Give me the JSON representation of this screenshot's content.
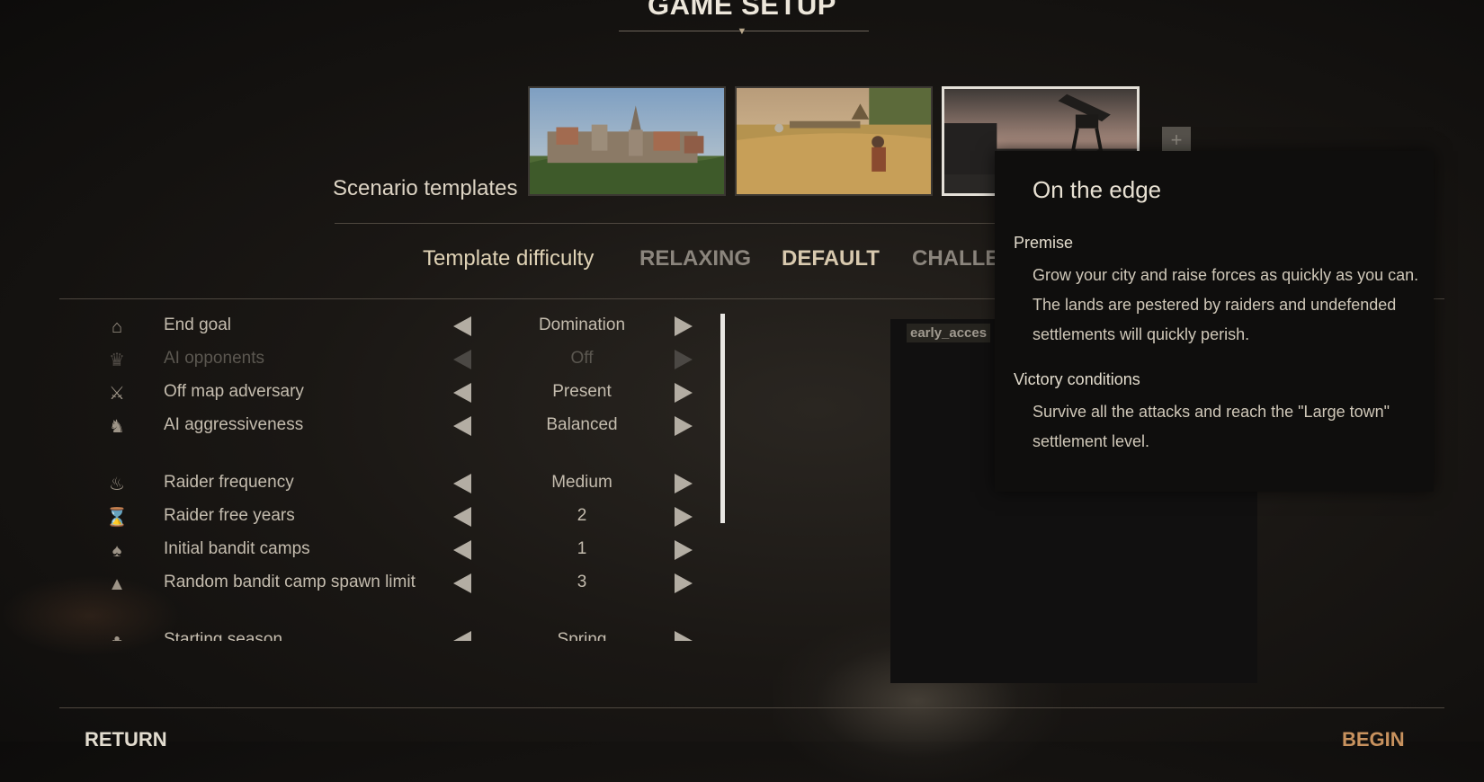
{
  "title": "GAME SETUP",
  "scenario": {
    "label": "Scenario templates",
    "thumbnails": [
      {
        "name": "walled-town-scene"
      },
      {
        "name": "wheat-field-scene"
      },
      {
        "name": "watchtower-scene",
        "selected": true
      }
    ],
    "add_icon": "+"
  },
  "difficulty": {
    "label": "Template difficulty",
    "options": [
      {
        "label": "RELAXING",
        "state": "dim"
      },
      {
        "label": "DEFAULT",
        "state": "active"
      },
      {
        "label": "CHALLENG",
        "state": "dim"
      }
    ]
  },
  "settings": [
    {
      "icon": "goal-icon",
      "label": "End goal",
      "value": "Domination",
      "enabled": true
    },
    {
      "icon": "crown-icon",
      "label": "AI opponents",
      "value": "Off",
      "enabled": false
    },
    {
      "icon": "crossed-swords-icon",
      "label": "Off map adversary",
      "value": "Present",
      "enabled": true
    },
    {
      "icon": "horse-head-icon",
      "label": "AI aggressiveness",
      "value": "Balanced",
      "enabled": true
    },
    {
      "icon": "fire-icon",
      "label": "Raider frequency",
      "value": "Medium",
      "enabled": true
    },
    {
      "icon": "hourglass-icon",
      "label": "Raider free years",
      "value": "2",
      "enabled": true
    },
    {
      "icon": "campfire-icon",
      "label": "Initial bandit camps",
      "value": "1",
      "enabled": true
    },
    {
      "icon": "tent-icon",
      "label": "Random bandit camp spawn limit",
      "value": "3",
      "enabled": true
    },
    {
      "icon": "season-icon",
      "label": "Starting season",
      "value": "Spring",
      "enabled": true
    }
  ],
  "tag_chip": "early_acces",
  "tooltip": {
    "title": "On the edge",
    "premise_heading": "Premise",
    "premise_text": "Grow your city and raise forces as quickly as you can. The lands are pestered by raiders and undefended settlements will quickly perish.",
    "victory_heading": "Victory conditions",
    "victory_text": "Survive all the attacks and reach the \"Large town\" settlement level."
  },
  "footer": {
    "return_label": "RETURN",
    "begin_label": "BEGIN"
  },
  "colors": {
    "begin_accent": "#c8925e",
    "difficulty_label": "#e0d3b6",
    "panel_bg": "#0f0e0d"
  }
}
